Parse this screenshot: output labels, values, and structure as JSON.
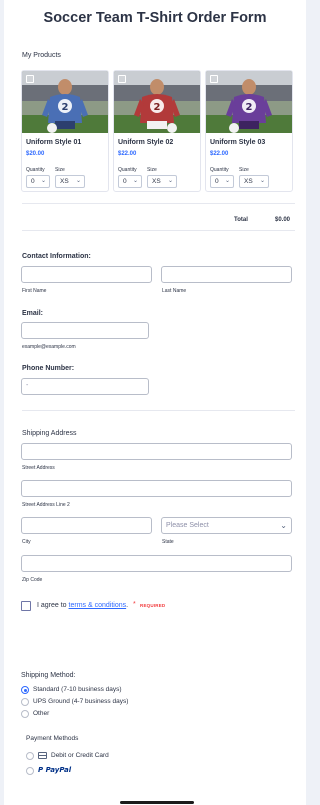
{
  "form": {
    "title": "Soccer Team T-Shirt Order Form",
    "products_label": "My Products",
    "products": [
      {
        "name": "Uniform Style 01",
        "price": "$20.00",
        "quantity_label": "Quantity",
        "size_label": "Size",
        "quantity": "0",
        "size": "XS",
        "jersey_color": "#4a6fb5"
      },
      {
        "name": "Uniform Style 02",
        "price": "$22.00",
        "quantity_label": "Quantity",
        "size_label": "Size",
        "quantity": "0",
        "size": "XS",
        "jersey_color": "#b23a3a"
      },
      {
        "name": "Uniform Style 03",
        "price": "$22.00",
        "quantity_label": "Quantity",
        "size_label": "Size",
        "quantity": "0",
        "size": "XS",
        "jersey_color": "#6a3e9a"
      }
    ],
    "jersey_number": "2",
    "total_label": "Total",
    "total_value": "$0.00",
    "contact": {
      "label": "Contact Information:",
      "first_name_sub": "First Name",
      "last_name_sub": "Last Name"
    },
    "email": {
      "label": "Email:",
      "sub": "example@example.com"
    },
    "phone": {
      "label": "Phone Number:",
      "placeholder": "-"
    },
    "shipping_address": {
      "label": "Shipping Address",
      "street_sub": "Street Address",
      "street2_sub": "Street Address Line 2",
      "city_sub": "City",
      "state_sub": "State",
      "state_placeholder": "Please Select",
      "zip_sub": "Zip Code"
    },
    "terms": {
      "prefix": "I agree to ",
      "link": "terms & conditions",
      "suffix": ".",
      "star": "*",
      "required": "REQUIRED"
    },
    "shipping_method": {
      "label": "Shipping Method:",
      "options": [
        "Standard (7-10 business days)",
        "UPS Ground (4-7 business days)",
        "Other"
      ],
      "selected_index": 0
    },
    "payment": {
      "label": "Payment Methods",
      "card_label": "Debit or Credit Card",
      "paypal_label": "PayPal"
    },
    "colors": {
      "accent": "#2e69ff",
      "required": "#f23a3c",
      "paypal_dark": "#003087",
      "paypal_light": "#009cde"
    }
  }
}
